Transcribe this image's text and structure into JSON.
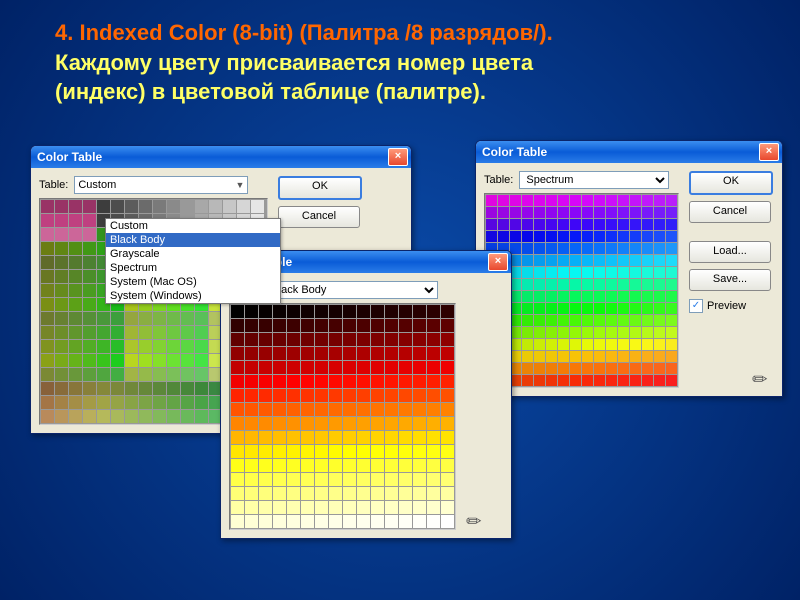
{
  "slide": {
    "line1": "4.      Indexed Color (8-bit) (Палитра /8 разрядов/).",
    "line2a": "Каждому цвету присваивается номер цвета",
    "line2b": "(индекс) в цветовой таблице (палитре)."
  },
  "common": {
    "title": "Color Table",
    "table_label": "Table:",
    "ok": "OK",
    "cancel": "Cancel",
    "load": "Load...",
    "save": "Save...",
    "preview": "Preview",
    "close_x": "×"
  },
  "d1": {
    "selected": "Custom",
    "options": [
      "Custom",
      "Black Body",
      "Grayscale",
      "Spectrum",
      "System (Mac OS)",
      "System (Windows)"
    ],
    "highlight": "Black Body"
  },
  "d2": {
    "selected": "Black Body"
  },
  "d3": {
    "selected": "Spectrum"
  }
}
